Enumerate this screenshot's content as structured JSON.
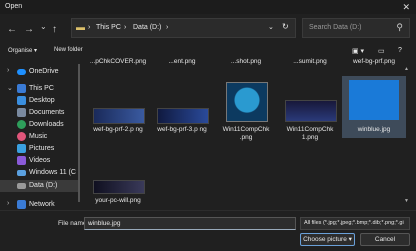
{
  "window": {
    "title": "Open"
  },
  "nav": {
    "back": "←",
    "forward": "→",
    "up_menu": "⌄",
    "up": "↑",
    "refresh": "↻"
  },
  "address": {
    "segments": [
      "This PC",
      "Data (D:)"
    ],
    "sep": "›"
  },
  "search": {
    "placeholder": "Search Data (D:)"
  },
  "commands": {
    "organise": "Organise ▾",
    "new_folder": "New folder"
  },
  "sidebar": {
    "items": [
      {
        "label": "OneDrive",
        "icon": "cloud-icon",
        "color": "#1e90ff",
        "chevron": "›"
      },
      {
        "label": "This PC",
        "icon": "computer-icon",
        "color": "#3a7bd5",
        "chevron": "⌄"
      },
      {
        "label": "Desktop",
        "icon": "desktop-icon",
        "color": "#3a8fe0"
      },
      {
        "label": "Documents",
        "icon": "documents-icon",
        "color": "#7a8aa0"
      },
      {
        "label": "Downloads",
        "icon": "download-icon",
        "color": "#2e9e5b"
      },
      {
        "label": "Music",
        "icon": "music-icon",
        "color": "#e0557a"
      },
      {
        "label": "Pictures",
        "icon": "pictures-icon",
        "color": "#3aa0e0"
      },
      {
        "label": "Videos",
        "icon": "video-icon",
        "color": "#8a5ad8"
      },
      {
        "label": "Windows 11 (C",
        "icon": "drive-icon",
        "color": "#5aa0e0"
      },
      {
        "label": "Data (D:)",
        "icon": "drive-icon",
        "color": "#9a9a9a"
      },
      {
        "label": "Network",
        "icon": "network-icon",
        "color": "#3a7bd5",
        "chevron": "›"
      }
    ]
  },
  "files": [
    {
      "name": "Win11CompChkCOVER.png",
      "display": "...pChkCOVER.png"
    },
    {
      "name": "...ent.png",
      "display": ""
    },
    {
      "name": "...shot.png",
      "display": ""
    },
    {
      "name": "...sumit.png",
      "display": ""
    },
    {
      "name": "wef-bg-prf.png",
      "display": ""
    },
    {
      "name": "wef-bg-prf-2.png",
      "display": "wef-bg-prf-2.p ng"
    },
    {
      "name": "wef-bg-prf-3.png",
      "display": "wef-bg-prf-3.p ng"
    },
    {
      "name": "Win11CompChk.png",
      "display": "Win11CompChk .png"
    },
    {
      "name": "Win11CompChk1.png",
      "display": "Win11CompChk 1.png"
    },
    {
      "name": "winblue.jpg",
      "display": "winblue.jpg"
    },
    {
      "name": "your-pc-will.png",
      "display": "your-pc-will.png"
    }
  ],
  "bottom": {
    "file_name_label": "File name:",
    "file_name_value": "winblue.jpg",
    "filter": "All files (*.jpg;*.jpeg;*.bmp;*.dib;*.png;*.gi",
    "open_button": "Choose picture ▾",
    "cancel_button": "Cancel"
  }
}
